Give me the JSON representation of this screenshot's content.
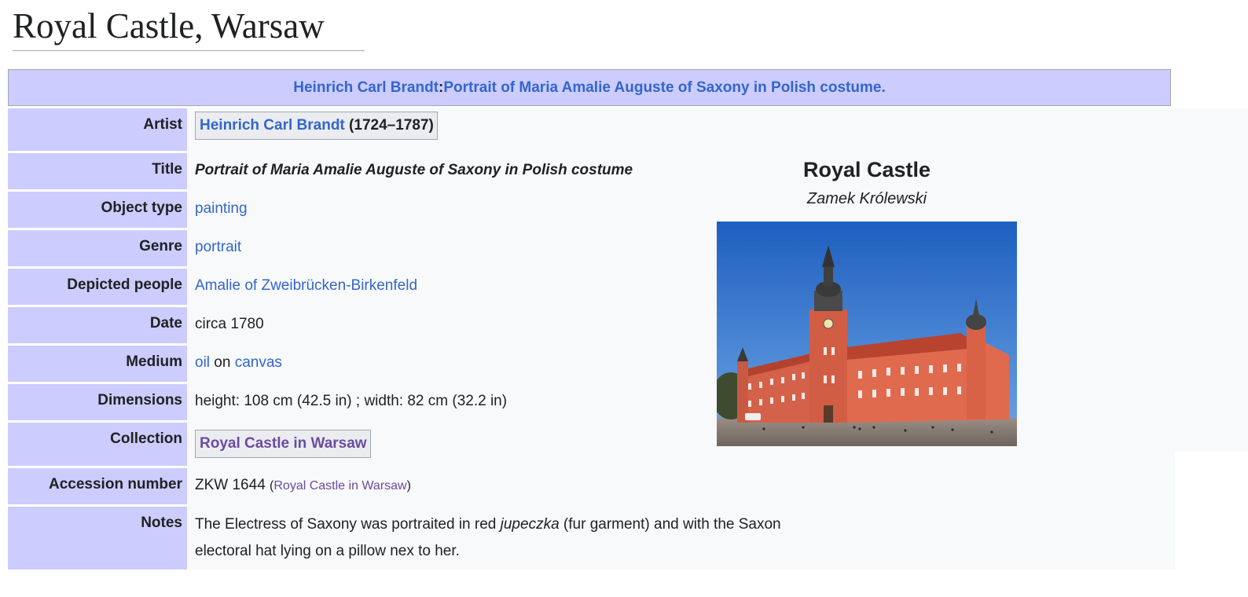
{
  "page": {
    "title": "Royal Castle, Warsaw"
  },
  "header": {
    "artist_link": "Heinrich Carl Brandt",
    "separator": ": ",
    "title_link": "Portrait of Maria Amalie Auguste of Saxony in Polish costume."
  },
  "rows": {
    "artist": {
      "label": "Artist",
      "link": "Heinrich Carl Brandt",
      "dates": " (1724–1787)"
    },
    "title": {
      "label": "Title",
      "value": "Portrait of Maria Amalie Auguste of Saxony in Polish costume"
    },
    "object_type": {
      "label": "Object type",
      "link": "painting"
    },
    "genre": {
      "label": "Genre",
      "link": "portrait"
    },
    "depicted": {
      "label": "Depicted people",
      "link": "Amalie of Zweibrücken-Birkenfeld"
    },
    "date": {
      "label": "Date",
      "value": "circa 1780"
    },
    "medium": {
      "label": "Medium",
      "link1": "oil",
      "middle": " on ",
      "link2": "canvas"
    },
    "dimensions": {
      "label": "Dimensions",
      "value": "height: 108 cm (42.5 in) ; width: 82 cm (32.2 in)"
    },
    "collection": {
      "label": "Collection",
      "link": "Royal Castle in Warsaw"
    },
    "accession": {
      "label": "Accession number",
      "value": "ZKW 1644 ",
      "paren_open": "(",
      "link": "Royal Castle in Warsaw",
      "paren_close": ")"
    },
    "notes": {
      "label": "Notes",
      "part1": "The Electress of Saxony was portraited in red ",
      "italic": "jupeczka",
      "part2": " (fur garment) and with the Saxon",
      "line2": "electoral hat lying on a pillow nex to her."
    }
  },
  "institution": {
    "name": "Royal Castle",
    "native_name": "Zamek Królewski"
  },
  "colors": {
    "label_bg": "#ccccff",
    "link": "#3366cc",
    "visited_link": "#6b4ba1",
    "panel_bg": "#f8f9fa"
  }
}
